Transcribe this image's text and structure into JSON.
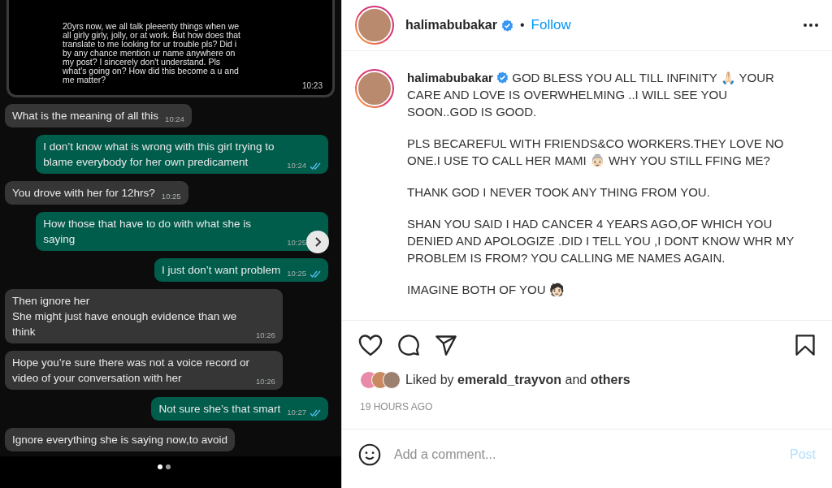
{
  "chat": {
    "quoted": {
      "text": "20yrs now, we all talk pleeenty things when we all girly girly, jolly, or at work. But how does that translate to me looking for ur trouble pls? Did i by any chance mention ur name anywhere on my post? I sincerely don't understand. Pls what's going on? How did this become a u and me matter?",
      "time": "10:23"
    },
    "messages": [
      {
        "kind": "incoming",
        "text": "What is the meaning of all this",
        "time": "10:24"
      },
      {
        "kind": "outgoing",
        "text": "I don’t know what is wrong with this girl trying to blame everybody for her own predicament",
        "time": "10:24"
      },
      {
        "kind": "incoming",
        "text": "You drove with her for 12hrs?",
        "time": "10:25"
      },
      {
        "kind": "outgoing",
        "text": "How those that have to do with what she is saying",
        "time": "10:25"
      },
      {
        "kind": "outgoing",
        "text": "I just don’t want problem",
        "time": "10:25"
      },
      {
        "kind": "incoming",
        "text": "Then ignore her\nShe might just have enough evidence than we think",
        "time": "10:26"
      },
      {
        "kind": "incoming",
        "text": "Hope you’re sure there was not  a voice record or video of your conversation with her",
        "time": "10:26"
      },
      {
        "kind": "outgoing",
        "text": "Not sure she’s that smart",
        "time": "10:27"
      },
      {
        "kind": "incoming",
        "text": "Ignore everything she is saying now,to avoid"
      }
    ],
    "carousel_dots": [
      {
        "selected": true
      },
      {
        "selected": false
      }
    ]
  },
  "header": {
    "username": "halimabubakar",
    "verified": true,
    "separator": "•",
    "follow": "Follow"
  },
  "caption": {
    "username": "halimabubakar",
    "verified": true,
    "paragraphs": [
      "GOD BLESS YOU ALL TILL INFINITY 🙏🏻 YOUR CARE AND LOVE IS OVERWHELMING ..I WILL SEE YOU SOON..GOD IS GOOD.",
      "PLS BECAREFUL WITH FRIENDS&CO WORKERS.THEY LOVE NO ONE.I USE TO CALL HER MAMI 👵🏻  WHY YOU STILL FFING ME?",
      "THANK GOD I NEVER TOOK ANY THING FROM YOU.",
      "SHAN YOU SAID I HAD CANCER 4 YEARS AGO,OF WHICH YOU DENIED AND APOLOGIZE .DID I TELL YOU ,I DONT KNOW WHR MY PROBLEM IS FROM? YOU CALLING ME NAMES AGAIN.",
      "IMAGINE BOTH OF YOU 🧑🏻"
    ]
  },
  "likes": {
    "text": "Liked by **emerald_trayvon** and **others**"
  },
  "time_ago": "19 HOURS AGO",
  "comment": {
    "placeholder": "Add a comment...",
    "post": "Post"
  }
}
